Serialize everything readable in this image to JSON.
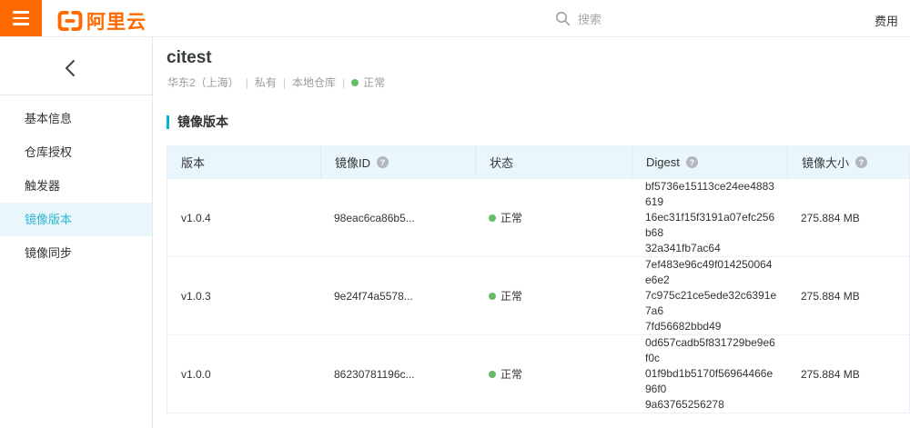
{
  "topbar": {
    "brand": "阿里云",
    "search_placeholder": "搜索",
    "billing_label": "费用"
  },
  "header": {
    "title": "citest",
    "region": "华东2（上海）",
    "visibility": "私有",
    "repo_type": "本地仓库",
    "status": "正常",
    "separator": "|"
  },
  "sidebar": {
    "items": [
      {
        "label": "基本信息"
      },
      {
        "label": "仓库授权"
      },
      {
        "label": "触发器"
      },
      {
        "label": "镜像版本"
      },
      {
        "label": "镜像同步"
      }
    ]
  },
  "main": {
    "section_title": "镜像版本",
    "table": {
      "columns": [
        "版本",
        "镜像ID",
        "状态",
        "Digest",
        "镜像大小"
      ],
      "rows": [
        {
          "version": "v1.0.4",
          "image_id": "98eac6ca86b5...",
          "status": "正常",
          "digest": "bf5736e15113ce24ee488361916ec31f15f3191a07efc256b6832a341fb7ac64",
          "digest_lines": [
            "bf5736e15113ce24ee4883619",
            "16ec31f15f3191a07efc256b68",
            "32a341fb7ac64"
          ],
          "size": "275.884 MB"
        },
        {
          "version": "v1.0.3",
          "image_id": "9e24f74a5578...",
          "status": "正常",
          "digest": "7ef483e96c49f014250064e6e27c975c21ce5ede32c6391e7a67fd56682bbd49",
          "digest_lines": [
            "7ef483e96c49f014250064e6e2",
            "7c975c21ce5ede32c6391e7a6",
            "7fd56682bbd49"
          ],
          "size": "275.884 MB"
        },
        {
          "version": "v1.0.0",
          "image_id": "86230781196c...",
          "status": "正常",
          "digest": "0d657cadb5f831729be9e6f0c01f9bd1b5170f56964466e96f09a63765256278",
          "digest_lines": [
            "0d657cadb5f831729be9e6f0c",
            "01f9bd1b5170f56964466e96f0",
            "9a63765256278"
          ],
          "size": "275.884 MB"
        }
      ]
    }
  },
  "icons": {
    "help": "?"
  },
  "colors": {
    "brand_orange": "#FF6A00",
    "accent_blue": "#00b4d8",
    "active_item_bg": "#e9f7fb",
    "table_header_bg": "#eaf6fd",
    "status_green": "#64bd63"
  }
}
